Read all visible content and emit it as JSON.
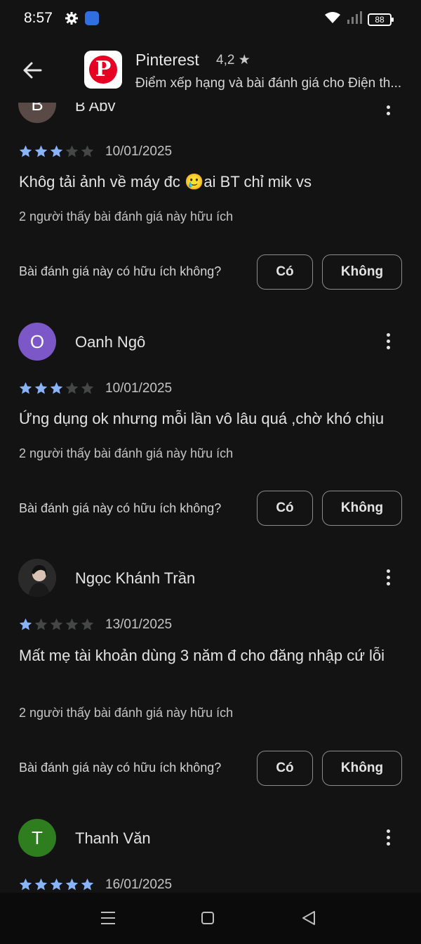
{
  "status_bar": {
    "time": "8:57",
    "battery": "88"
  },
  "header": {
    "app_name": "Pinterest",
    "rating": "4,2 ★",
    "subtitle": "Điểm xếp hạng và bài đánh giá cho Điện th..."
  },
  "reviews": [
    {
      "initial": "B",
      "name": "B Abv",
      "avatar_color": "#5a4a46",
      "stars": 3,
      "date": "10/01/2025",
      "text": "Khôg tải ảnh về máy đc 🥲ai BT chỉ mik vs",
      "helpful_count": "2 người thấy bài đánh giá này hữu ích",
      "helpful_question": "Bài đánh giá này có hữu ích không?",
      "yes_label": "Có",
      "no_label": "Không"
    },
    {
      "initial": "O",
      "name": "Oanh Ngô",
      "avatar_color": "#7b57c8",
      "stars": 3,
      "date": "10/01/2025",
      "text": "Ứng dụng ok nhưng mỗi lần vô lâu quá ,chờ khó chịu",
      "helpful_count": "2 người thấy bài đánh giá này hữu ích",
      "helpful_question": "Bài đánh giá này có hữu ích không?",
      "yes_label": "Có",
      "no_label": "Không"
    },
    {
      "initial": "",
      "name": "Ngọc Khánh Trần",
      "avatar_color": "#3a3a3a",
      "stars": 1,
      "date": "13/01/2025",
      "text": "Mất mẹ tài khoản dùng 3 năm đ cho đăng nhập cứ lỗi",
      "helpful_count": "2 người thấy bài đánh giá này hữu ích",
      "helpful_question": "Bài đánh giá này có hữu ích không?",
      "yes_label": "Có",
      "no_label": "Không"
    },
    {
      "initial": "T",
      "name": "Thanh Văn",
      "avatar_color": "#2e7d1f",
      "stars": 5,
      "date": "16/01/2025"
    }
  ]
}
